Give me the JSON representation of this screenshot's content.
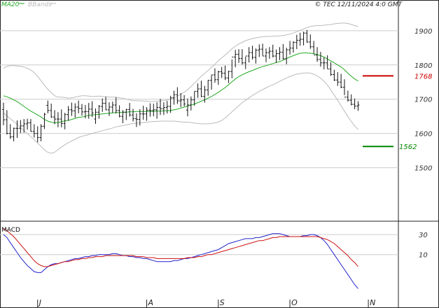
{
  "header": {
    "ma_label": "MA20",
    "bb_label": "BBands",
    "copyright": "© TEC 12/11/2024 4:0 GMT"
  },
  "chart_data": [
    {
      "type": "candlestick",
      "panel": "price",
      "title": "",
      "xlabel": "",
      "ylabel": "",
      "ylim": [
        1350,
        1965
      ],
      "y_ticks": [
        "1900",
        "1800",
        "1700",
        "1600",
        "1500"
      ],
      "x_ticks": [
        {
          "label": "J",
          "index": 10
        },
        {
          "label": "A",
          "index": 42
        },
        {
          "label": "S",
          "index": 63
        },
        {
          "label": "O",
          "index": 84
        },
        {
          "label": "N",
          "index": 107
        }
      ],
      "colors": {
        "bars": "#111111",
        "ma": "#22aa22",
        "bands": "#bbbbbb",
        "resistance": "#cc0000",
        "support": "#008800",
        "grid": "#cccccc"
      },
      "ohlc": {
        "open": [
          1670,
          1640,
          1600,
          1590,
          1615,
          1615,
          1622,
          1628,
          1631,
          1606,
          1600,
          1588,
          1621,
          1682,
          1667,
          1648,
          1642,
          1642,
          1629,
          1655,
          1669,
          1666,
          1677,
          1673,
          1663,
          1664,
          1671,
          1642,
          1662,
          1679,
          1688,
          1669,
          1677,
          1683,
          1667,
          1650,
          1662,
          1670,
          1654,
          1643,
          1641,
          1657,
          1657,
          1668,
          1667,
          1669,
          1676,
          1672,
          1676,
          1679,
          1704,
          1713,
          1695,
          1698,
          1668,
          1683,
          1698,
          1723,
          1730,
          1708,
          1727,
          1755,
          1771,
          1757,
          1780,
          1776,
          1762,
          1781,
          1823,
          1831,
          1819,
          1806,
          1826,
          1836,
          1822,
          1843,
          1846,
          1826,
          1836,
          1840,
          1826,
          1833,
          1837,
          1818,
          1844,
          1849,
          1866,
          1872,
          1875,
          1893,
          1867,
          1853,
          1829,
          1816,
          1806,
          1806,
          1788,
          1772,
          1756,
          1750,
          1735,
          1706,
          1697,
          1685,
          1680
        ],
        "high": [
          1690,
          1668,
          1627,
          1617,
          1638,
          1639,
          1642,
          1643,
          1642,
          1627,
          1621,
          1627,
          1660,
          1696,
          1687,
          1668,
          1662,
          1670,
          1660,
          1680,
          1690,
          1688,
          1696,
          1686,
          1683,
          1689,
          1694,
          1673,
          1683,
          1702,
          1707,
          1691,
          1693,
          1705,
          1682,
          1668,
          1672,
          1689,
          1672,
          1659,
          1671,
          1681,
          1677,
          1688,
          1687,
          1691,
          1701,
          1691,
          1695,
          1710,
          1725,
          1735,
          1718,
          1712,
          1702,
          1708,
          1722,
          1746,
          1754,
          1739,
          1756,
          1770,
          1790,
          1783,
          1794,
          1798,
          1783,
          1816,
          1844,
          1846,
          1846,
          1824,
          1852,
          1856,
          1848,
          1860,
          1862,
          1848,
          1852,
          1859,
          1845,
          1852,
          1861,
          1850,
          1870,
          1869,
          1888,
          1894,
          1897,
          1902,
          1889,
          1870,
          1852,
          1838,
          1822,
          1828,
          1808,
          1786,
          1779,
          1774,
          1758,
          1725,
          1714,
          1702,
          1694
        ],
        "low": [
          1624,
          1597,
          1584,
          1577,
          1587,
          1601,
          1602,
          1611,
          1606,
          1588,
          1574,
          1577,
          1613,
          1659,
          1646,
          1627,
          1618,
          1618,
          1612,
          1637,
          1651,
          1646,
          1659,
          1652,
          1644,
          1643,
          1648,
          1628,
          1643,
          1663,
          1668,
          1651,
          1660,
          1658,
          1647,
          1630,
          1639,
          1649,
          1635,
          1619,
          1623,
          1640,
          1637,
          1649,
          1650,
          1643,
          1654,
          1654,
          1658,
          1660,
          1684,
          1686,
          1677,
          1679,
          1650,
          1667,
          1681,
          1704,
          1706,
          1690,
          1710,
          1728,
          1748,
          1742,
          1762,
          1756,
          1747,
          1761,
          1793,
          1806,
          1801,
          1788,
          1807,
          1816,
          1804,
          1823,
          1827,
          1808,
          1818,
          1822,
          1806,
          1814,
          1816,
          1802,
          1830,
          1836,
          1846,
          1856,
          1857,
          1865,
          1847,
          1833,
          1809,
          1795,
          1787,
          1789,
          1768,
          1753,
          1739,
          1732,
          1712,
          1693,
          1682,
          1671,
          1666
        ],
        "close": [
          1640,
          1600,
          1590,
          1615,
          1615,
          1622,
          1628,
          1631,
          1606,
          1600,
          1588,
          1621,
          1656,
          1667,
          1648,
          1642,
          1642,
          1629,
          1655,
          1669,
          1666,
          1677,
          1673,
          1663,
          1664,
          1671,
          1660,
          1662,
          1679,
          1688,
          1669,
          1677,
          1683,
          1667,
          1650,
          1662,
          1670,
          1654,
          1643,
          1641,
          1657,
          1657,
          1668,
          1667,
          1669,
          1676,
          1672,
          1676,
          1679,
          1704,
          1713,
          1695,
          1698,
          1686,
          1683,
          1698,
          1723,
          1730,
          1708,
          1727,
          1755,
          1771,
          1757,
          1780,
          1776,
          1762,
          1781,
          1823,
          1831,
          1819,
          1806,
          1826,
          1836,
          1822,
          1843,
          1846,
          1826,
          1836,
          1840,
          1826,
          1833,
          1837,
          1818,
          1844,
          1849,
          1866,
          1872,
          1875,
          1893,
          1867,
          1853,
          1829,
          1816,
          1806,
          1806,
          1788,
          1772,
          1756,
          1750,
          1735,
          1706,
          1697,
          1685,
          1680,
          1683
        ]
      },
      "ma20": {
        "start_index": 0,
        "values": [
          1710,
          1707,
          1703,
          1698,
          1693,
          1686,
          1679,
          1672,
          1665,
          1660,
          1654,
          1648,
          1641,
          1636,
          1633,
          1631,
          1632,
          1634,
          1637,
          1638,
          1641,
          1644,
          1647,
          1648,
          1650,
          1653,
          1654,
          1655,
          1656,
          1657,
          1658,
          1659,
          1660,
          1661,
          1661,
          1662,
          1662,
          1663,
          1663,
          1664,
          1664,
          1664,
          1664,
          1664,
          1664,
          1665,
          1665,
          1666,
          1666,
          1667,
          1669,
          1671,
          1674,
          1677,
          1680,
          1683,
          1686,
          1690,
          1694,
          1698,
          1703,
          1708,
          1714,
          1720,
          1727,
          1734,
          1742,
          1751,
          1759,
          1766,
          1771,
          1776,
          1780,
          1784,
          1788,
          1792,
          1795,
          1798,
          1801,
          1804,
          1807,
          1810,
          1814,
          1819,
          1823,
          1827,
          1831,
          1834,
          1835,
          1835,
          1834,
          1833,
          1830,
          1827,
          1823,
          1817,
          1812,
          1806,
          1800,
          1794,
          1786,
          1776,
          1767,
          1759,
          1753
        ]
      },
      "bbands_upper": {
        "start_index": 0,
        "values": [
          1790,
          1796,
          1798,
          1798,
          1797,
          1796,
          1794,
          1790,
          1785,
          1778,
          1767,
          1754,
          1741,
          1729,
          1719,
          1710,
          1706,
          1706,
          1705,
          1703,
          1704,
          1706,
          1708,
          1710,
          1710,
          1709,
          1708,
          1708,
          1709,
          1708,
          1707,
          1706,
          1706,
          1706,
          1704,
          1703,
          1700,
          1698,
          1696,
          1696,
          1695,
          1695,
          1694,
          1693,
          1693,
          1694,
          1695,
          1696,
          1698,
          1700,
          1703,
          1709,
          1715,
          1720,
          1728,
          1737,
          1747,
          1757,
          1767,
          1775,
          1784,
          1793,
          1802,
          1812,
          1821,
          1829,
          1838,
          1847,
          1855,
          1861,
          1866,
          1871,
          1874,
          1877,
          1879,
          1881,
          1882,
          1883,
          1883,
          1884,
          1884,
          1885,
          1886,
          1888,
          1890,
          1893,
          1897,
          1901,
          1905,
          1909,
          1912,
          1914,
          1915,
          1915,
          1916,
          1917,
          1918,
          1920,
          1921,
          1922,
          1922,
          1921,
          1918,
          1915,
          1912
        ]
      },
      "bbands_lower": {
        "start_index": 0,
        "values": [
          1660,
          1651,
          1643,
          1635,
          1626,
          1617,
          1609,
          1600,
          1590,
          1582,
          1572,
          1562,
          1552,
          1545,
          1542,
          1545,
          1553,
          1560,
          1567,
          1573,
          1578,
          1583,
          1588,
          1592,
          1594,
          1597,
          1600,
          1603,
          1605,
          1608,
          1611,
          1613,
          1616,
          1619,
          1621,
          1623,
          1625,
          1627,
          1629,
          1630,
          1631,
          1632,
          1633,
          1634,
          1635,
          1635,
          1636,
          1636,
          1636,
          1636,
          1636,
          1635,
          1634,
          1633,
          1633,
          1632,
          1630,
          1629,
          1628,
          1628,
          1628,
          1629,
          1631,
          1633,
          1638,
          1645,
          1654,
          1663,
          1672,
          1681,
          1690,
          1697,
          1704,
          1711,
          1717,
          1723,
          1728,
          1733,
          1738,
          1742,
          1747,
          1752,
          1757,
          1762,
          1766,
          1770,
          1773,
          1775,
          1776,
          1777,
          1776,
          1773,
          1768,
          1761,
          1752,
          1741,
          1727,
          1712,
          1697,
          1681,
          1665,
          1649,
          1635,
          1622,
          1611
        ]
      },
      "levels": [
        {
          "name": "resistance",
          "value": 1768,
          "label": "1768"
        },
        {
          "name": "support",
          "value": 1562,
          "label": "1562"
        }
      ]
    },
    {
      "type": "line",
      "panel": "macd",
      "title": "MACD",
      "xlabel": "",
      "ylabel": "",
      "ylim": [
        -42,
        42
      ],
      "y_ticks": [
        {
          "label": "30",
          "value": 30
        },
        {
          "label": "10",
          "value": 10
        }
      ],
      "colors": {
        "macd": "#2222cc",
        "signal": "#cc1111",
        "grid": "#cccccc"
      },
      "series": [
        {
          "name": "",
          "role": "macd",
          "values": [
            30,
            27,
            22,
            17,
            12,
            7,
            3,
            -1,
            -4,
            -7,
            -8,
            -8,
            -5,
            -2,
            0,
            1,
            1,
            2,
            3,
            4,
            5,
            6,
            6,
            7,
            8,
            8,
            9,
            9,
            10,
            10,
            10,
            10,
            11,
            11,
            10,
            9,
            9,
            8,
            8,
            7,
            7,
            6,
            6,
            5,
            4,
            3,
            3,
            3,
            3,
            3,
            4,
            4,
            5,
            6,
            6,
            7,
            8,
            9,
            10,
            11,
            12,
            13,
            14,
            15,
            17,
            19,
            21,
            22,
            23,
            24,
            25,
            26,
            26,
            26,
            27,
            27,
            28,
            29,
            30,
            31,
            31,
            31,
            30,
            29,
            28,
            28,
            28,
            28,
            29,
            29,
            30,
            30,
            29,
            27,
            24,
            20,
            15,
            10,
            5,
            0,
            -5,
            -10,
            -15,
            -20,
            -24
          ]
        },
        {
          "name": "",
          "role": "signal",
          "values": [
            36,
            34,
            31,
            28,
            24,
            20,
            16,
            12,
            8,
            4,
            1,
            -1,
            -2,
            -2,
            -1,
            0,
            1,
            2,
            3,
            3,
            4,
            5,
            5,
            6,
            6,
            7,
            7,
            8,
            8,
            8,
            9,
            9,
            9,
            9,
            9,
            9,
            9,
            9,
            9,
            8,
            8,
            8,
            7,
            7,
            7,
            6,
            6,
            6,
            6,
            6,
            6,
            6,
            6,
            6,
            7,
            7,
            7,
            8,
            8,
            9,
            10,
            10,
            11,
            12,
            13,
            14,
            15,
            16,
            17,
            18,
            19,
            20,
            21,
            22,
            23,
            24,
            24,
            25,
            26,
            27,
            27,
            28,
            28,
            28,
            28,
            28,
            28,
            28,
            28,
            28,
            28,
            28,
            28,
            27,
            26,
            25,
            23,
            21,
            18,
            15,
            12,
            9,
            5,
            2,
            -2
          ]
        }
      ]
    }
  ]
}
